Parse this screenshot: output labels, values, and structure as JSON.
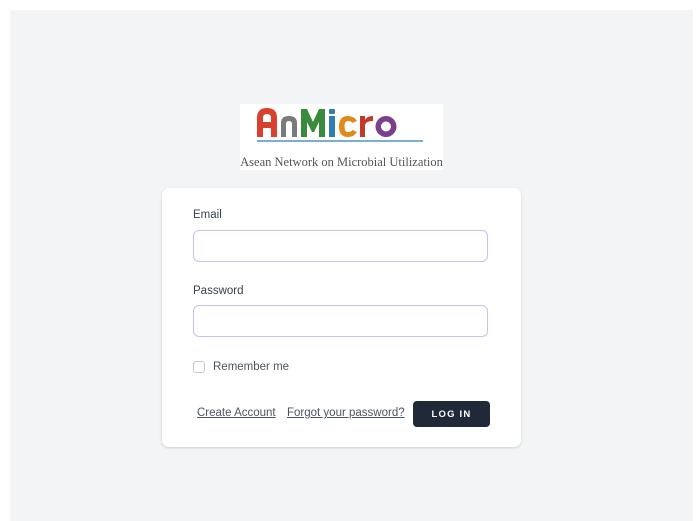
{
  "logo": {
    "text": "AnMicro",
    "tagline": "Asean Network on Microbial Utilization",
    "colors": [
      "#d9412f",
      "#7a7a7a",
      "#3a8a3e",
      "#2c7db8",
      "#e08a1e",
      "#c0392b",
      "#7b3f8c"
    ]
  },
  "form": {
    "email_label": "Email",
    "email_value": "",
    "password_label": "Password",
    "password_value": "",
    "remember_label": "Remember me",
    "remember_checked": false,
    "create_account_label": "Create Account",
    "forgot_password_label": "Forgot your password?",
    "login_label": "LOG IN"
  },
  "colors": {
    "page_background": "#f3f4f6",
    "card_background": "#ffffff",
    "input_border": "#c4c3f0",
    "button_background": "#1f2937",
    "button_text": "#ffffff"
  }
}
